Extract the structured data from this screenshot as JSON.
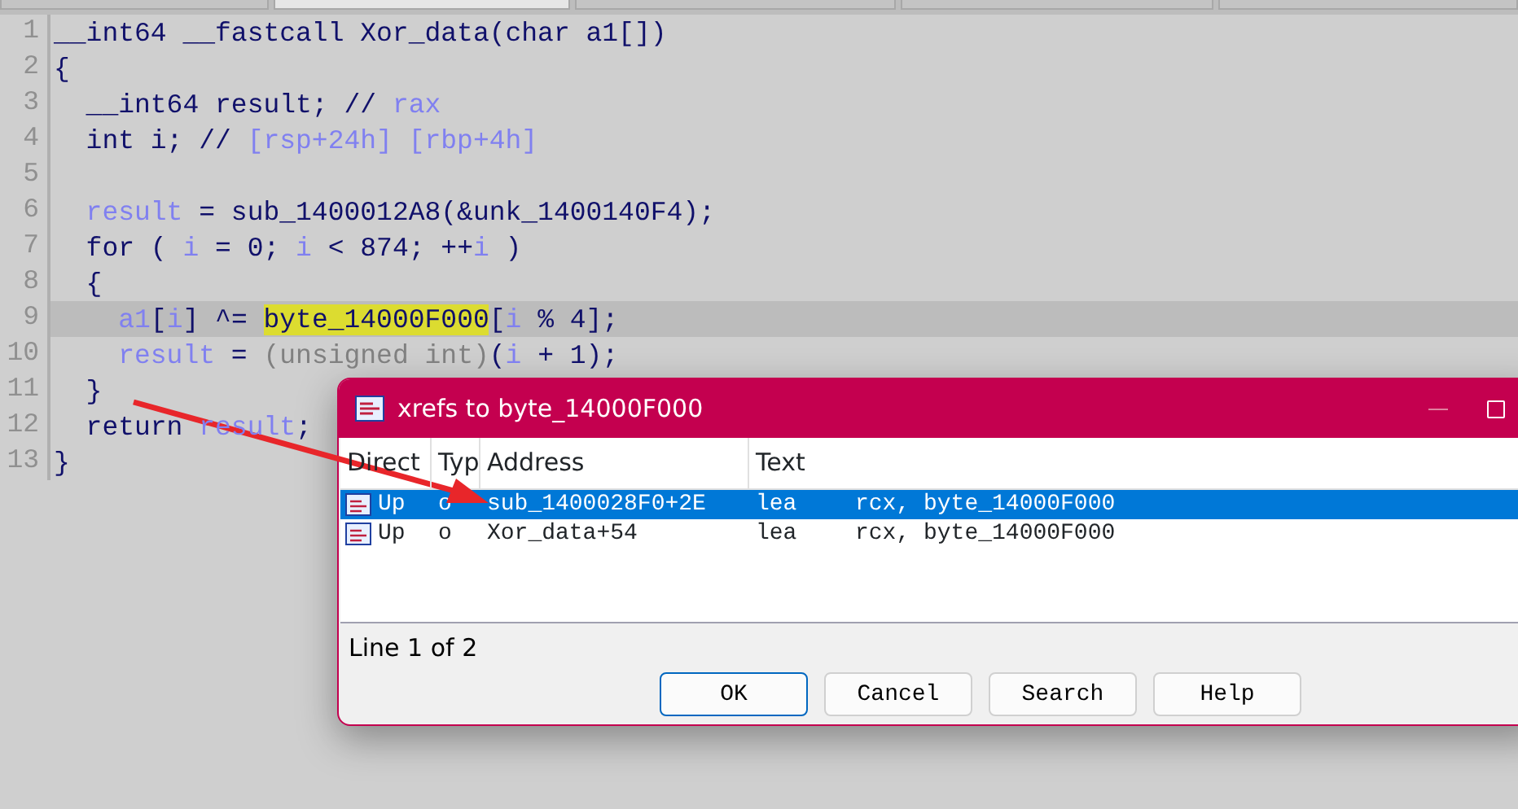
{
  "tabs": [
    {
      "selected": false
    },
    {
      "selected": true
    },
    {
      "selected": false
    },
    {
      "selected": false
    },
    {
      "selected": false
    }
  ],
  "code_lines": [
    {
      "number": "1",
      "selected": false,
      "tokens": [
        {
          "kind": "code",
          "text": "__int64 __fastcall Xor_data(char a1[])"
        }
      ]
    },
    {
      "number": "2",
      "selected": false,
      "tokens": [
        {
          "kind": "code",
          "text": "{"
        }
      ]
    },
    {
      "number": "3",
      "selected": false,
      "tokens": [
        {
          "kind": "code",
          "text": "  __int64 result; // "
        },
        {
          "kind": "var",
          "text": "rax"
        }
      ]
    },
    {
      "number": "4",
      "selected": false,
      "tokens": [
        {
          "kind": "code",
          "text": "  int i; // "
        },
        {
          "kind": "var",
          "text": "[rsp+24h] [rbp+4h]"
        }
      ]
    },
    {
      "number": "5",
      "selected": false
    },
    {
      "number": "6",
      "selected": false,
      "tokens": [
        {
          "kind": "var",
          "text": "  result"
        },
        {
          "kind": "code",
          "text": " = sub_1400012A8(&unk_1400140F4);"
        }
      ]
    },
    {
      "number": "7",
      "selected": false,
      "tokens": [
        {
          "kind": "code",
          "text": "  for ( "
        },
        {
          "kind": "var",
          "text": "i"
        },
        {
          "kind": "code",
          "text": " = 0; "
        },
        {
          "kind": "var",
          "text": "i"
        },
        {
          "kind": "code",
          "text": " < 874; ++"
        },
        {
          "kind": "var",
          "text": "i"
        },
        {
          "kind": "code",
          "text": " )"
        }
      ]
    },
    {
      "number": "8",
      "selected": false,
      "tokens": [
        {
          "kind": "code",
          "text": "  {"
        }
      ]
    },
    {
      "number": "9",
      "selected": true,
      "tokens": [
        {
          "kind": "var",
          "text": "    a1"
        },
        {
          "kind": "code",
          "text": "["
        },
        {
          "kind": "var",
          "text": "i"
        },
        {
          "kind": "code",
          "text": "] ^= "
        },
        {
          "kind": "highlight",
          "text": "byte_14000F000"
        },
        {
          "kind": "code",
          "text": "["
        },
        {
          "kind": "var",
          "text": "i"
        },
        {
          "kind": "code",
          "text": " % 4];"
        }
      ]
    },
    {
      "number": "10",
      "selected": false,
      "tokens": [
        {
          "kind": "var",
          "text": "    result"
        },
        {
          "kind": "code",
          "text": " = "
        },
        {
          "kind": "cast",
          "text": "(unsigned int)"
        },
        {
          "kind": "code",
          "text": "("
        },
        {
          "kind": "var",
          "text": "i"
        },
        {
          "kind": "code",
          "text": " + 1);"
        }
      ]
    },
    {
      "number": "11",
      "selected": false,
      "tokens": [
        {
          "kind": "code",
          "text": "  }"
        }
      ]
    },
    {
      "number": "12",
      "selected": false,
      "tokens": [
        {
          "kind": "code",
          "text": "  return "
        },
        {
          "kind": "var",
          "text": "result"
        },
        {
          "kind": "code",
          "text": ";"
        }
      ]
    },
    {
      "number": "13",
      "selected": false,
      "tokens": [
        {
          "kind": "code",
          "text": "}"
        }
      ]
    }
  ],
  "dialog": {
    "title": "xrefs to byte_14000F000",
    "columns": [
      "Direct",
      "Typ",
      "Address",
      "Text"
    ],
    "rows": [
      {
        "selected": true,
        "direction": "Up",
        "type": "o",
        "address": "sub_1400028F0+2E",
        "mnemonic": "lea",
        "operands": "rcx, byte_14000F000"
      },
      {
        "selected": false,
        "direction": "Up",
        "type": "o",
        "address": "Xor_data+54",
        "mnemonic": "lea",
        "operands": "rcx, byte_14000F000"
      }
    ],
    "status": "Line 1 of 2",
    "buttons": [
      {
        "label": "OK",
        "default": true
      },
      {
        "label": "Cancel",
        "default": false
      },
      {
        "label": "Search",
        "default": false
      },
      {
        "label": "Help",
        "default": false
      }
    ]
  }
}
